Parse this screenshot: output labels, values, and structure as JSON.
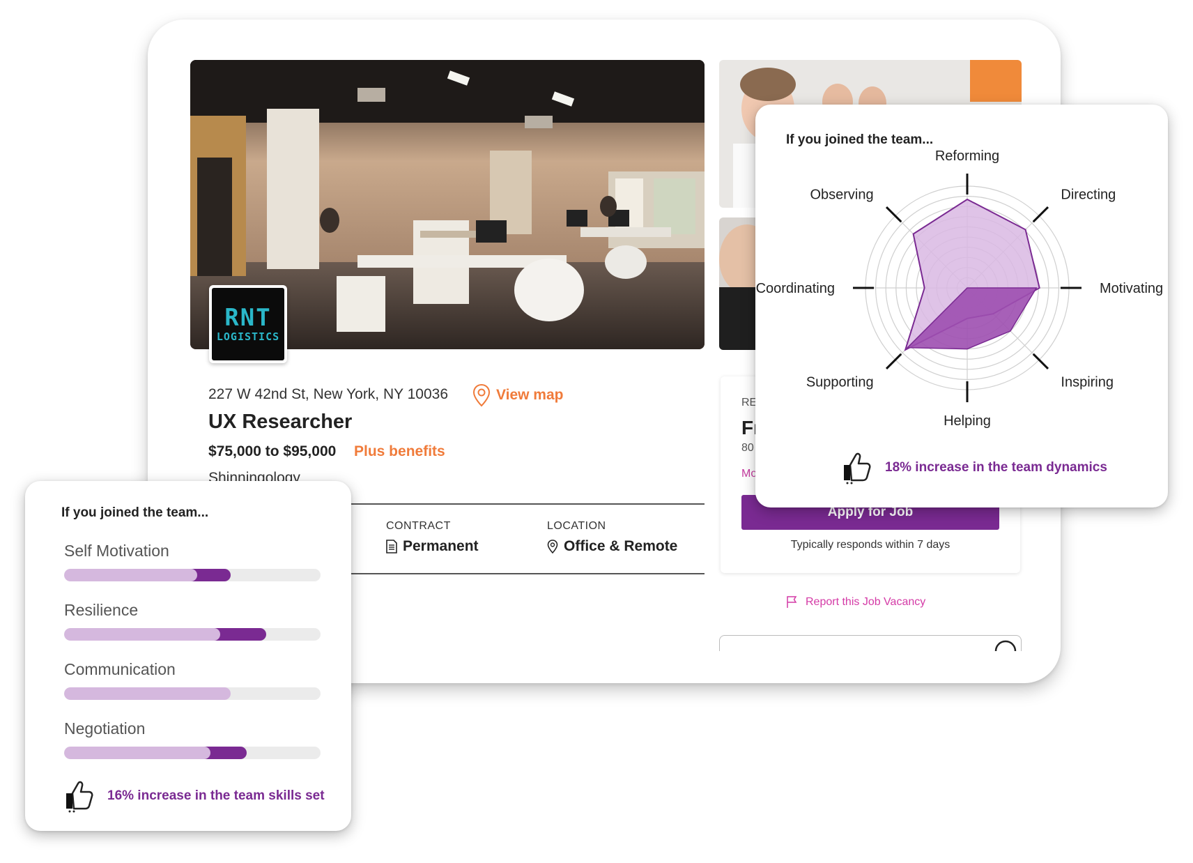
{
  "listing": {
    "address": "227 W 42nd St, New York, NY 10036",
    "view_map": "View map",
    "title": "UX Researcher",
    "salary": "$75,000 to $95,000",
    "benefits": "Plus benefits",
    "company": "Shinningology",
    "logo_line1": "RNT",
    "logo_line2": "LOGISTICS",
    "contract_label": "CONTRACT",
    "contract_value": "Permanent",
    "location_label": "LOCATION",
    "location_value": "Office & Remote"
  },
  "apply": {
    "re_text": "RE",
    "fr_text": "Fr",
    "num_text": "80",
    "mo_text": "Mo",
    "button": "Apply for Job",
    "responds": "Typically responds within 7 days",
    "report": "Report this Job Vacancy"
  },
  "radar_popup": {
    "heading": "If you joined the team...",
    "footer": "18% increase in the team dynamics",
    "colors": {
      "light_fill": "#d9b8e3",
      "dark_fill": "#9d4fb0",
      "accent": "#7a2a92"
    },
    "chart_data": {
      "type": "radar",
      "axes": [
        "Reforming",
        "Directing",
        "Motivating",
        "Inspiring",
        "Helping",
        "Supporting",
        "Coordinating",
        "Observing"
      ],
      "range": [
        0,
        100
      ],
      "series": [
        {
          "values": [
            87,
            81,
            71,
            36,
            30,
            86,
            42,
            75
          ]
        },
        {
          "values": [
            0,
            0,
            68,
            60,
            60,
            83,
            0,
            0
          ]
        }
      ]
    }
  },
  "skills_popup": {
    "heading": "If you joined the team...",
    "footer": "16% increase in the team skills set",
    "skills": [
      {
        "name": "Self Motivation",
        "current": 0.52,
        "increase": 0.13
      },
      {
        "name": "Resilience",
        "current": 0.61,
        "increase": 0.18
      },
      {
        "name": "Communication",
        "current": 0.65,
        "increase": 0.0
      },
      {
        "name": "Negotiation",
        "current": 0.57,
        "increase": 0.14
      }
    ]
  }
}
